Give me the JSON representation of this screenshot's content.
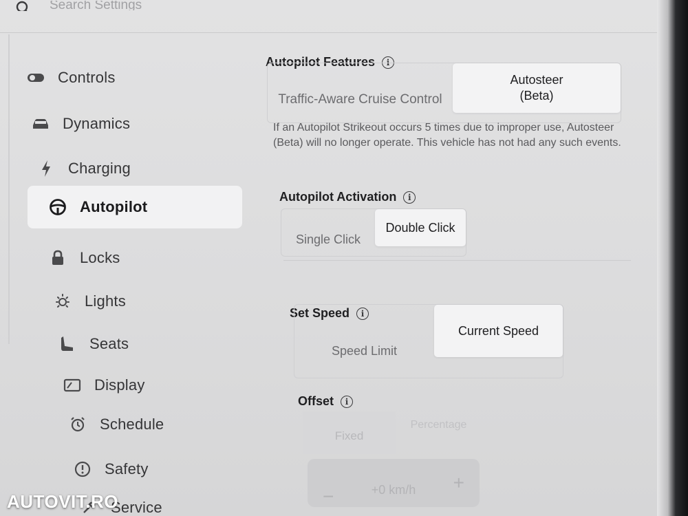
{
  "search": {
    "placeholder": "Search Settings"
  },
  "sidebar": {
    "items": [
      {
        "label": "Controls",
        "icon": "toggle-icon"
      },
      {
        "label": "Dynamics",
        "icon": "car-icon"
      },
      {
        "label": "Charging",
        "icon": "bolt-icon"
      },
      {
        "label": "Autopilot",
        "icon": "steering-wheel-icon",
        "active": true
      },
      {
        "label": "Locks",
        "icon": "lock-icon"
      },
      {
        "label": "Lights",
        "icon": "sun-icon"
      },
      {
        "label": "Seats",
        "icon": "seat-icon"
      },
      {
        "label": "Display",
        "icon": "display-icon"
      },
      {
        "label": "Schedule",
        "icon": "alarm-clock-icon"
      },
      {
        "label": "Safety",
        "icon": "warning-circle-icon"
      },
      {
        "label": "Service",
        "icon": "wrench-icon"
      }
    ]
  },
  "autopilot_features": {
    "heading": "Autopilot Features",
    "options": [
      "Traffic-Aware Cruise Control",
      "Autosteer (Beta)"
    ],
    "selected": "Autosteer (Beta)",
    "description": "If an Autopilot Strikeout occurs 5 times due to improper use, Autosteer (Beta) will no longer operate. This vehicle has not had any such events."
  },
  "autopilot_activation": {
    "heading": "Autopilot Activation",
    "options": [
      "Single Click",
      "Double Click"
    ],
    "selected": "Double Click"
  },
  "set_speed": {
    "heading": "Set Speed",
    "options": [
      "Speed Limit",
      "Current Speed"
    ],
    "selected": "Current Speed"
  },
  "offset": {
    "heading": "Offset",
    "options": [
      "Fixed",
      "Percentage"
    ],
    "value": "+0 km/h",
    "minus": "−",
    "plus": "+"
  },
  "watermark": "AUTOVIT.RO",
  "colors": {
    "selected_bg": "#f3f3f4",
    "screen_bg": "#dcdcdd",
    "text": "#1f1f21"
  }
}
